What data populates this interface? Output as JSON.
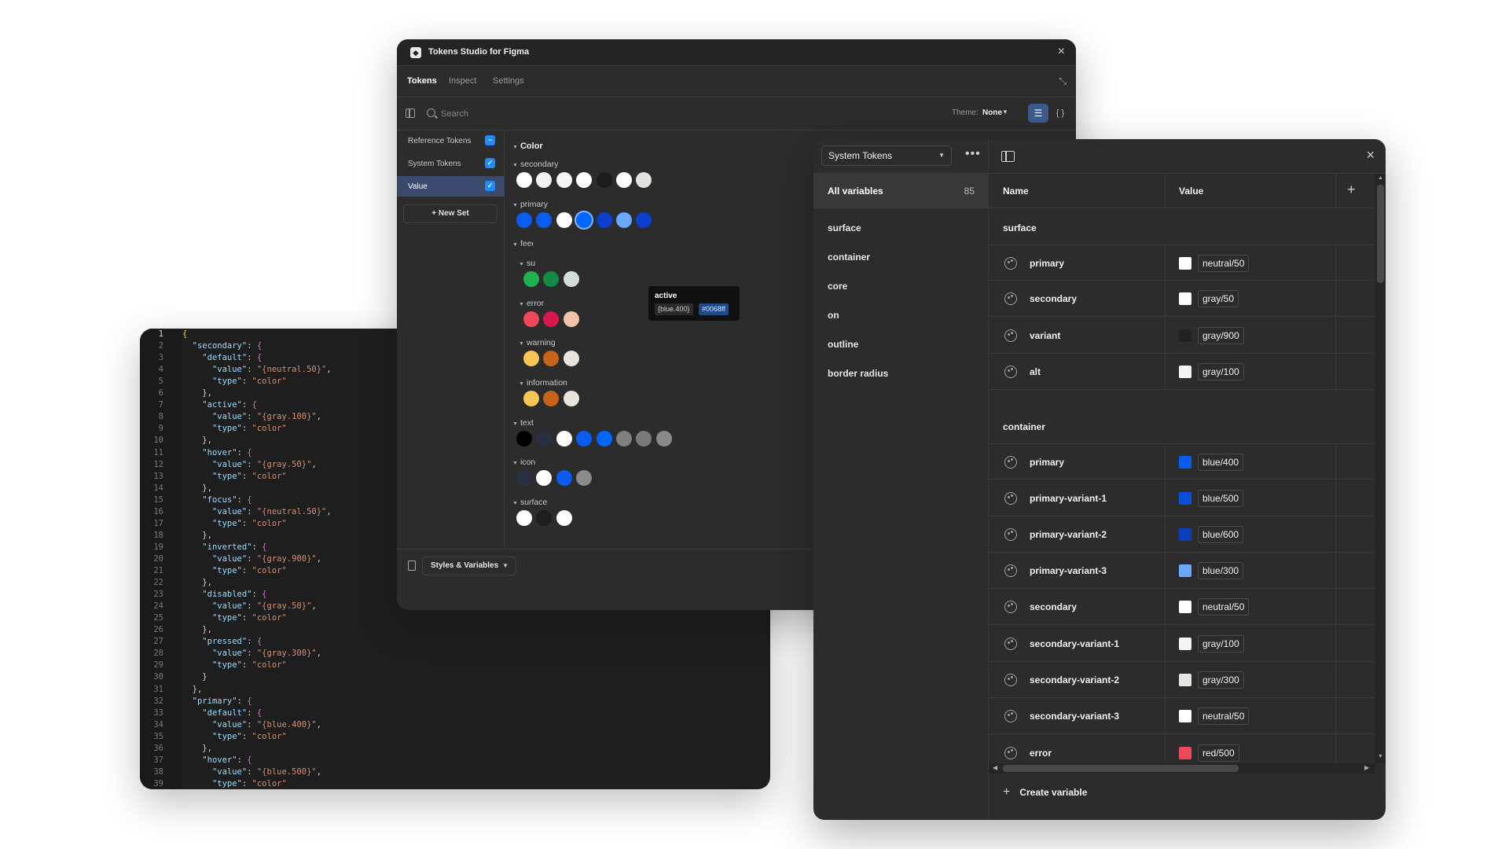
{
  "editor": {
    "lines": [
      {
        "n": "1",
        "code": "{"
      },
      {
        "n": "2",
        "code": "  \"secondary\": {"
      },
      {
        "n": "3",
        "code": "    \"default\": {"
      },
      {
        "n": "4",
        "code": "      \"value\": \"{neutral.50}\","
      },
      {
        "n": "5",
        "code": "      \"type\": \"color\""
      },
      {
        "n": "6",
        "code": "    },"
      },
      {
        "n": "7",
        "code": "    \"active\": {"
      },
      {
        "n": "8",
        "code": "      \"value\": \"{gray.100}\","
      },
      {
        "n": "9",
        "code": "      \"type\": \"color\""
      },
      {
        "n": "10",
        "code": "    },"
      },
      {
        "n": "11",
        "code": "    \"hover\": {"
      },
      {
        "n": "12",
        "code": "      \"value\": \"{gray.50}\","
      },
      {
        "n": "13",
        "code": "      \"type\": \"color\""
      },
      {
        "n": "14",
        "code": "    },"
      },
      {
        "n": "15",
        "code": "    \"focus\": {"
      },
      {
        "n": "16",
        "code": "      \"value\": \"{neutral.50}\","
      },
      {
        "n": "17",
        "code": "      \"type\": \"color\""
      },
      {
        "n": "18",
        "code": "    },"
      },
      {
        "n": "19",
        "code": "    \"inverted\": {"
      },
      {
        "n": "20",
        "code": "      \"value\": \"{gray.900}\","
      },
      {
        "n": "21",
        "code": "      \"type\": \"color\""
      },
      {
        "n": "22",
        "code": "    },"
      },
      {
        "n": "23",
        "code": "    \"disabled\": {"
      },
      {
        "n": "24",
        "code": "      \"value\": \"{gray.50}\","
      },
      {
        "n": "25",
        "code": "      \"type\": \"color\""
      },
      {
        "n": "26",
        "code": "    },"
      },
      {
        "n": "27",
        "code": "    \"pressed\": {"
      },
      {
        "n": "28",
        "code": "      \"value\": \"{gray.300}\","
      },
      {
        "n": "29",
        "code": "      \"type\": \"color\""
      },
      {
        "n": "30",
        "code": "    }"
      },
      {
        "n": "31",
        "code": "  },"
      },
      {
        "n": "32",
        "code": "  \"primary\": {"
      },
      {
        "n": "33",
        "code": "    \"default\": {"
      },
      {
        "n": "34",
        "code": "      \"value\": \"{blue.400}\","
      },
      {
        "n": "35",
        "code": "      \"type\": \"color\""
      },
      {
        "n": "36",
        "code": "    },"
      },
      {
        "n": "37",
        "code": "    \"hover\": {"
      },
      {
        "n": "38",
        "code": "      \"value\": \"{blue.500}\","
      },
      {
        "n": "39",
        "code": "      \"type\": \"color\""
      }
    ]
  },
  "plugin": {
    "title": "Tokens Studio for Figma",
    "tabs": [
      {
        "label": "Tokens",
        "active": true
      },
      {
        "label": "Inspect",
        "active": false
      },
      {
        "label": "Settings",
        "active": false
      }
    ],
    "search_placeholder": "Search",
    "theme_label": "Theme:",
    "theme_value": "None",
    "sets": [
      {
        "label": "Reference Tokens",
        "check": "−",
        "active": false
      },
      {
        "label": "System Tokens",
        "check": "✓",
        "active": false
      },
      {
        "label": "Value",
        "check": "✓",
        "active": true
      }
    ],
    "new_set_label": "New Set",
    "color_heading": "Color",
    "groups": [
      {
        "label": "secondary",
        "swatches": [
          "#ffffff",
          "#f2f2f2",
          "#f7f7f7",
          "#ffffff",
          "#1c1c1c",
          "#ffffff",
          "#e2e2de"
        ]
      },
      {
        "label": "primary",
        "swatches": [
          "#0a5cf0",
          "#0a5cf0",
          "#ffffff",
          "#0068ff",
          "#0a3fd0",
          "#6aa8ff",
          "#0a3fd0"
        ]
      },
      {
        "label": "feedback",
        "swatches": []
      },
      {
        "label": "success",
        "swatches": [
          "#1fb04f",
          "#148a44",
          "#d4ded8"
        ]
      },
      {
        "label": "error",
        "swatches": [
          "#f0475a",
          "#d8184a",
          "#f2c2a6"
        ]
      },
      {
        "label": "warning",
        "swatches": [
          "#f6c554",
          "#c7641a",
          "#e8e4dc"
        ]
      },
      {
        "label": "information",
        "swatches": [
          "#f6c554",
          "#c7641a",
          "#e8e4dc"
        ]
      },
      {
        "label": "text",
        "swatches": [
          "#000000",
          "#2a3040",
          "#ffffff",
          "#0a5cf0",
          "#0068ff",
          "#808080",
          "#7a7a7a",
          "#8a8a8a"
        ]
      },
      {
        "label": "icon",
        "swatches": [
          "#2a3040",
          "#ffffff",
          "#0a5cf0",
          "#8a8a8a"
        ]
      },
      {
        "label": "surface",
        "swatches": [
          "#ffffff",
          "#1e1e1e",
          "#ffffff"
        ]
      }
    ],
    "tooltip": {
      "title": "active",
      "ref": "{blue.400}",
      "hex": "#0068ff"
    },
    "styles_dropdown_label": "Styles & Variables"
  },
  "variables": {
    "collection": "System Tokens",
    "all_label": "All variables",
    "all_count": "85",
    "groups": [
      "surface",
      "container",
      "core",
      "on",
      "outline",
      "border radius"
    ],
    "col_name": "Name",
    "col_value": "Value",
    "sections": [
      {
        "title": "surface",
        "rows": [
          {
            "name": "primary",
            "value": "neutral/50",
            "color": "#ffffff"
          },
          {
            "name": "secondary",
            "value": "gray/50",
            "color": "#fafafa"
          },
          {
            "name": "variant",
            "value": "gray/900",
            "color": "#222222"
          },
          {
            "name": "alt",
            "value": "gray/100",
            "color": "#f4f4f4"
          }
        ]
      },
      {
        "title": "container",
        "rows": [
          {
            "name": "primary",
            "value": "blue/400",
            "color": "#0a5cf0"
          },
          {
            "name": "primary-variant-1",
            "value": "blue/500",
            "color": "#0a4fdc"
          },
          {
            "name": "primary-variant-2",
            "value": "blue/600",
            "color": "#0a3fc0"
          },
          {
            "name": "primary-variant-3",
            "value": "blue/300",
            "color": "#6aa8ff"
          },
          {
            "name": "secondary",
            "value": "neutral/50",
            "color": "#ffffff"
          },
          {
            "name": "secondary-variant-1",
            "value": "gray/100",
            "color": "#f4f4f4"
          },
          {
            "name": "secondary-variant-2",
            "value": "gray/300",
            "color": "#e6e6e0"
          },
          {
            "name": "secondary-variant-3",
            "value": "neutral/50",
            "color": "#ffffff"
          },
          {
            "name": "error",
            "value": "red/500",
            "color": "#f0475a"
          }
        ]
      }
    ],
    "create_label": "Create variable"
  }
}
